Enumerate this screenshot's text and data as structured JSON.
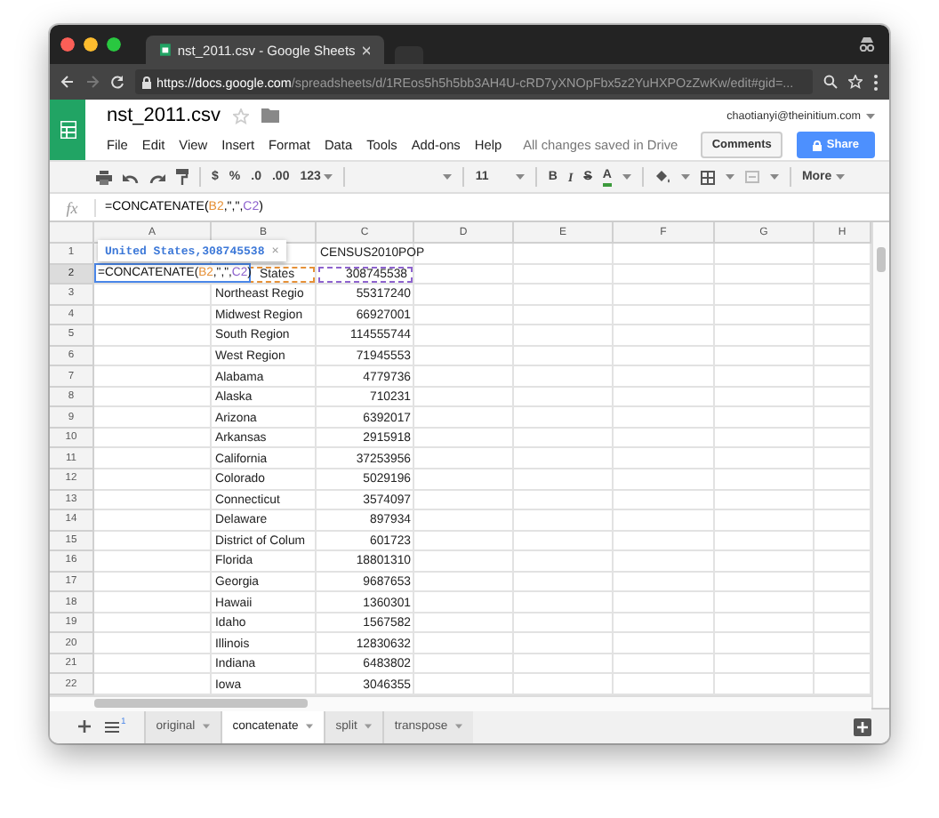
{
  "browser": {
    "tab_title": "nst_2011.csv - Google Sheets",
    "url_host": "https://docs.google.com",
    "url_path": "/spreadsheets/d/1REos5h5h5bb3AH4U-cRD7yXNOpFbx5z2YuHXPOzZwKw/edit#gid=..."
  },
  "doc": {
    "title": "nst_2011.csv",
    "account": "chaotianyi@theinitium.com",
    "save_status": "All changes saved in Drive",
    "comments": "Comments",
    "share": "Share"
  },
  "menu": [
    "File",
    "Edit",
    "View",
    "Insert",
    "Format",
    "Data",
    "Tools",
    "Add-ons",
    "Help"
  ],
  "toolbar": {
    "currency": "$",
    "percent": "%",
    "decrease_decimals": ".0",
    "increase_decimals": ".00",
    "number_format": "123",
    "font_size": "11",
    "bold": "B",
    "italic": "I",
    "strike": "S",
    "text_color": "A",
    "more": "More"
  },
  "formula_bar": {
    "label": "fx",
    "parts": [
      {
        "text": "=CONCATENATE("
      },
      {
        "text": "B2",
        "color": "#e69138"
      },
      {
        "text": ",\",\","
      },
      {
        "text": "C2",
        "color": "#8e63ce"
      },
      {
        "text": ")"
      }
    ]
  },
  "editor": {
    "tooltip": "United States,308745538",
    "close": "×",
    "parts": [
      {
        "text": "=CONCATENATE("
      },
      {
        "text": "B2",
        "color": "#e69138"
      },
      {
        "text": ",\",\","
      },
      {
        "text": "C2",
        "color": "#8e63ce"
      },
      {
        "text": ")"
      }
    ]
  },
  "columns": [
    "A",
    "B",
    "C",
    "D",
    "E",
    "F",
    "G",
    "H"
  ],
  "rows": [
    {
      "num": "1",
      "b": "",
      "c": "CENSUS2010POP",
      "selected": false
    },
    {
      "num": "2",
      "b": "States",
      "c": "308745538",
      "selected": true
    },
    {
      "num": "3",
      "b": "Northeast Regio",
      "c": "55317240",
      "selected": false
    },
    {
      "num": "4",
      "b": "Midwest Region",
      "c": "66927001",
      "selected": false
    },
    {
      "num": "5",
      "b": "South Region",
      "c": "114555744",
      "selected": false
    },
    {
      "num": "6",
      "b": "West Region",
      "c": "71945553",
      "selected": false
    },
    {
      "num": "7",
      "b": "Alabama",
      "c": "4779736",
      "selected": false
    },
    {
      "num": "8",
      "b": "Alaska",
      "c": "710231",
      "selected": false
    },
    {
      "num": "9",
      "b": "Arizona",
      "c": "6392017",
      "selected": false
    },
    {
      "num": "10",
      "b": "Arkansas",
      "c": "2915918",
      "selected": false
    },
    {
      "num": "11",
      "b": "California",
      "c": "37253956",
      "selected": false
    },
    {
      "num": "12",
      "b": "Colorado",
      "c": "5029196",
      "selected": false
    },
    {
      "num": "13",
      "b": "Connecticut",
      "c": "3574097",
      "selected": false
    },
    {
      "num": "14",
      "b": "Delaware",
      "c": "897934",
      "selected": false
    },
    {
      "num": "15",
      "b": "District of Colum",
      "c": "601723",
      "selected": false
    },
    {
      "num": "16",
      "b": "Florida",
      "c": "18801310",
      "selected": false
    },
    {
      "num": "17",
      "b": "Georgia",
      "c": "9687653",
      "selected": false
    },
    {
      "num": "18",
      "b": "Hawaii",
      "c": "1360301",
      "selected": false
    },
    {
      "num": "19",
      "b": "Idaho",
      "c": "1567582",
      "selected": false
    },
    {
      "num": "20",
      "b": "Illinois",
      "c": "12830632",
      "selected": false
    },
    {
      "num": "21",
      "b": "Indiana",
      "c": "6483802",
      "selected": false
    },
    {
      "num": "22",
      "b": "Iowa",
      "c": "3046355",
      "selected": false
    }
  ],
  "sheet_count": "1",
  "sheets": [
    {
      "label": "original",
      "selected": false
    },
    {
      "label": "concatenate",
      "selected": true
    },
    {
      "label": "split",
      "selected": false
    },
    {
      "label": "transpose",
      "selected": false
    }
  ]
}
